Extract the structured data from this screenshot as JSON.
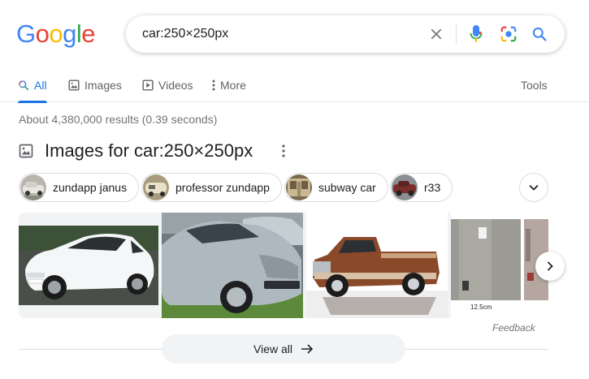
{
  "logo": {
    "letters": [
      {
        "ch": "G",
        "color": "#4285F4"
      },
      {
        "ch": "o",
        "color": "#EA4335"
      },
      {
        "ch": "o",
        "color": "#FBBC05"
      },
      {
        "ch": "g",
        "color": "#4285F4"
      },
      {
        "ch": "l",
        "color": "#34A853"
      },
      {
        "ch": "e",
        "color": "#EA4335"
      }
    ]
  },
  "search": {
    "query": "car:250×250px",
    "icons": [
      "close-icon",
      "mic-icon",
      "lens-icon",
      "search-icon"
    ]
  },
  "tabs": [
    {
      "label": "All",
      "icon": "search-icon",
      "active": true
    },
    {
      "label": "Images",
      "icon": "image-icon",
      "active": false
    },
    {
      "label": "Videos",
      "icon": "play-icon",
      "active": false
    },
    {
      "label": "More",
      "icon": "kebab-icon",
      "active": false
    }
  ],
  "tools_label": "Tools",
  "result_stats": "About 4,380,000 results (0.39 seconds)",
  "images_section": {
    "title": "Images for car:250×250px",
    "chips": [
      {
        "label": "zundapp janus"
      },
      {
        "label": "professor zundapp"
      },
      {
        "label": "subway car"
      },
      {
        "label": "r33"
      }
    ],
    "tiles": [
      {
        "alt": "white hatchback"
      },
      {
        "alt": "silver sedan"
      },
      {
        "alt": "pickup truck"
      },
      {
        "alt": "aerial view",
        "caption": "12.5cm"
      }
    ]
  },
  "feedback_label": "Feedback",
  "view_all_label": "View all",
  "colors": {
    "accent": "#1a73e8",
    "text_secondary": "#70757a"
  }
}
